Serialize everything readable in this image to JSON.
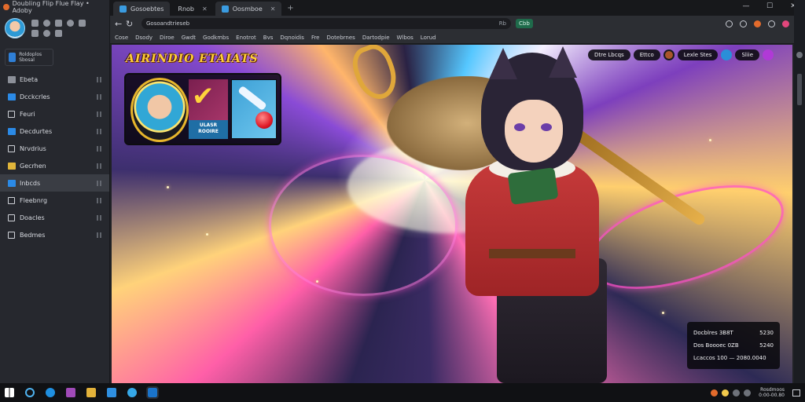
{
  "left_panel": {
    "title": "Doubling Flip Flue Flay • Adoby",
    "account": "Roldoplos Sbosal",
    "items": [
      {
        "label": "Ebeta",
        "icon": "folder-icon"
      },
      {
        "label": "Dcckcrles",
        "icon": "folder-icon"
      },
      {
        "label": "Feuri",
        "icon": "image-icon"
      },
      {
        "label": "Decdurtes",
        "icon": "folder-icon"
      },
      {
        "label": "Nrvdrius",
        "icon": "image-icon"
      },
      {
        "label": "Gecrhen",
        "icon": "folder-icon"
      },
      {
        "label": "Inbcds",
        "icon": "folder-icon"
      },
      {
        "label": "Fleebnrg",
        "icon": "checkbox-icon"
      },
      {
        "label": "Doacles",
        "icon": "checkbox-icon"
      },
      {
        "label": "Bedmes",
        "icon": "gear-icon"
      }
    ]
  },
  "browser": {
    "tabs": [
      {
        "label": "Gosoebtes"
      },
      {
        "label": "Rnob"
      },
      {
        "label": "Oosmboe"
      }
    ],
    "url": "Gosoandtrieseb",
    "url_right": "Rb",
    "pill": "Cbb",
    "bookmarks": [
      "Cose",
      "Dsody",
      "Diroe",
      "Gwdt",
      "Godkmbs",
      "Enotrot",
      "Bvs",
      "Dqnoidis",
      "Fre",
      "Dotebrnes",
      "Dartodpie",
      "Wlbos",
      "Lorud"
    ]
  },
  "game": {
    "title": "AIRINDIO ETAIATS",
    "badge": "ULASR ROOIRE",
    "hud": [
      "Dtre Lbcqs",
      "Ettco",
      "Lexle Stes",
      "Sliie"
    ],
    "stats": [
      {
        "label": "Docblres 3B8T",
        "value": "5230"
      },
      {
        "label": "Dos Boooec 0ZB",
        "value": "5240"
      },
      {
        "label": "Lcaccos 100 — 2080.0040",
        "value": ""
      }
    ]
  },
  "taskbar": {
    "clock_top": "Rosdmoos",
    "clock_bottom": "0:00-00.80"
  }
}
